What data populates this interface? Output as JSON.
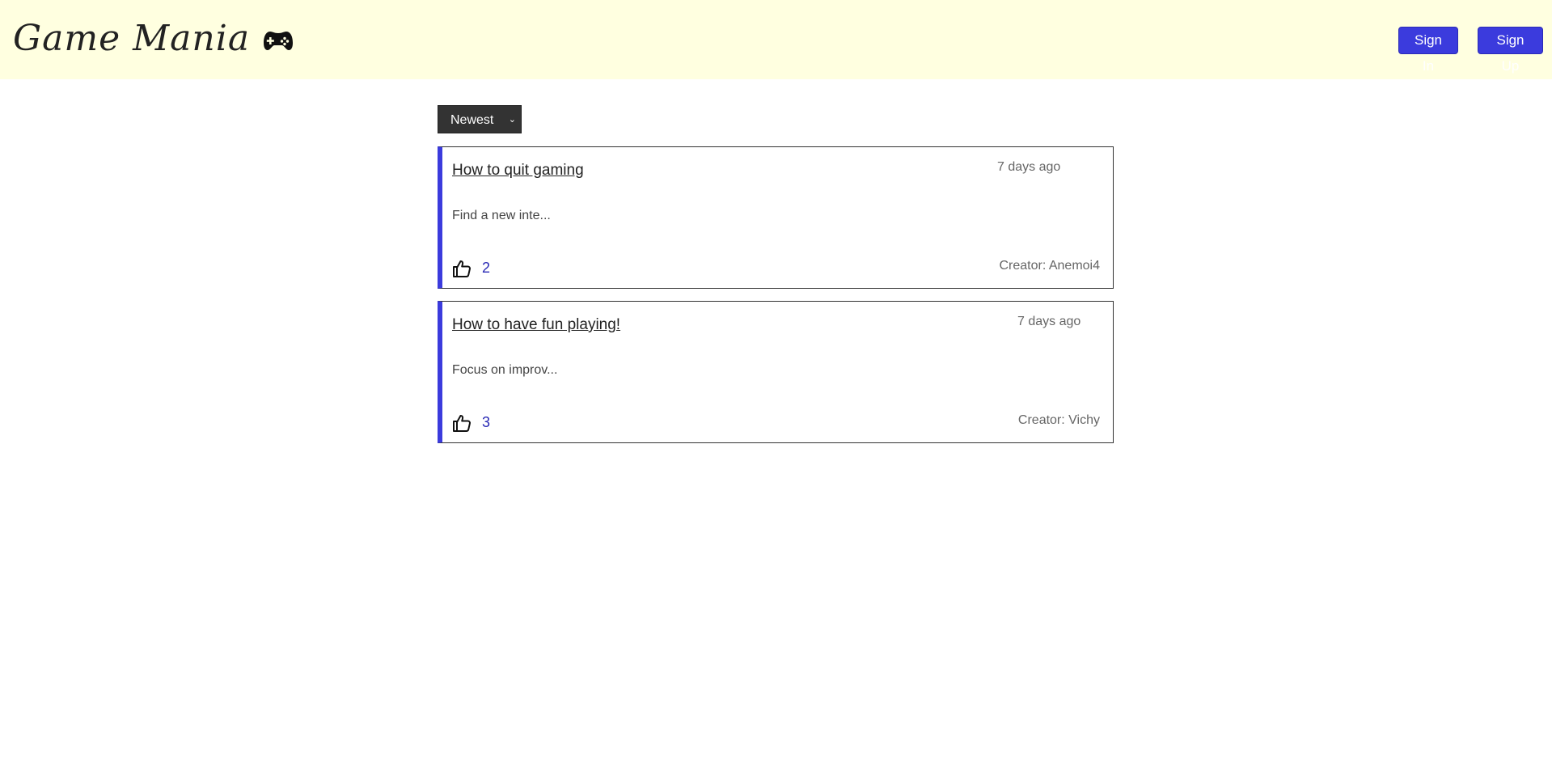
{
  "header": {
    "brand": "Game Mania",
    "brand_icon": "gamepad-icon",
    "sign_in_label": "Sign In",
    "sign_up_label": "Sign Up",
    "background_color": "#ffffe0",
    "accent_color": "#3b3bdd"
  },
  "sort": {
    "selected": "Newest"
  },
  "posts": [
    {
      "title": "How to quit gaming",
      "time": "7 days ago",
      "excerpt": "Find a new inte...",
      "likes": "2",
      "creator_label": "Creator:",
      "creator": "Anemoi4"
    },
    {
      "title": "How to have fun playing!",
      "time": "7 days ago",
      "excerpt": "Focus on improv...",
      "likes": "3",
      "creator_label": "Creator:",
      "creator": "Vichy"
    }
  ]
}
